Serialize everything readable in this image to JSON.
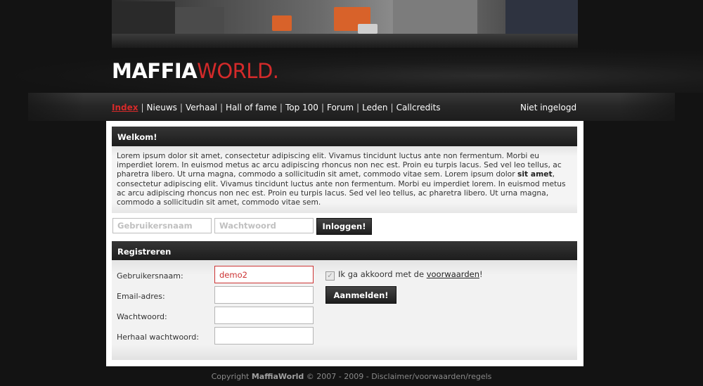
{
  "site": {
    "logo_part1": "MAFFIA",
    "logo_part2": "WORLD",
    "logo_dot": "."
  },
  "nav": {
    "items": [
      {
        "label": "Index",
        "active": true
      },
      {
        "label": "Nieuws",
        "active": false
      },
      {
        "label": "Verhaal",
        "active": false
      },
      {
        "label": "Hall of fame",
        "active": false
      },
      {
        "label": "Top 100",
        "active": false
      },
      {
        "label": "Forum",
        "active": false
      },
      {
        "label": "Leden",
        "active": false
      },
      {
        "label": "Callcredits",
        "active": false
      }
    ],
    "separator": "|",
    "status": "Niet ingelogd"
  },
  "welcome": {
    "title": "Welkom!",
    "text_part1": "Lorem ipsum dolor sit amet, consectetur adipiscing elit. Vivamus tincidunt luctus ante non fermentum. Morbi eu imperdiet lorem. In euismod metus ac arcu adipiscing rhoncus non nec est. Proin eu turpis lacus. Sed vel leo tellus, ac pharetra libero. Ut urna magna, commodo a sollicitudin sit amet, commodo vitae sem. Lorem ipsum dolor ",
    "text_bold": "sit amet",
    "text_part2": ", consectetur adipiscing elit. Vivamus tincidunt luctus ante non fermentum. Morbi eu imperdiet lorem. In euismod metus ac arcu adipiscing rhoncus non nec est. Proin eu turpis lacus. Sed vel leo tellus, ac pharetra libero. Ut urna magna, commodo a sollicitudin sit amet, commodo vitae sem."
  },
  "login": {
    "username_placeholder": "Gebruikersnaam",
    "password_placeholder": "Wachtwoord",
    "submit_label": "Inloggen!"
  },
  "register": {
    "title": "Registreren",
    "username_label": "Gebruikersnaam:",
    "username_value": "demo2",
    "email_label": "Email-adres:",
    "password_label": "Wachtwoord:",
    "repeat_label": "Herhaal wachtwoord:",
    "agree_text": "Ik ga akkoord met de ",
    "agree_link": "voorwaarden",
    "agree_suffix": "!",
    "agree_checked": true,
    "submit_label": "Aanmelden!"
  },
  "footer": {
    "prefix": "Copyright ",
    "brand": "MaffiaWorld",
    "suffix": " © 2007 - 2009 - Disclaimer/voorwaarden/regels"
  },
  "colors": {
    "background": "#131313",
    "accent_red": "#d42a2a",
    "header_dark": "#1c1c1c",
    "panel_light": "#f4f4f4"
  }
}
